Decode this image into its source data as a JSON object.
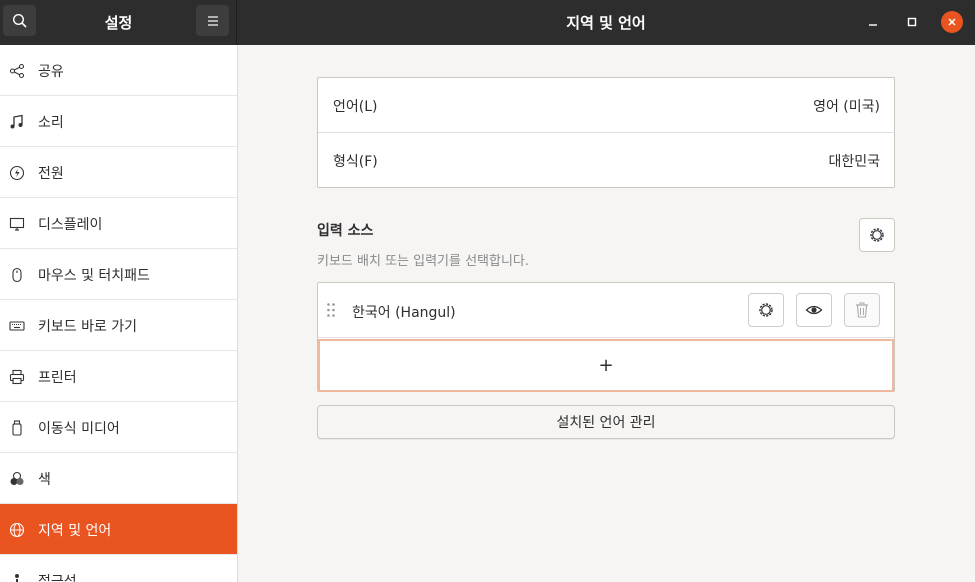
{
  "header": {
    "left_title": "설정",
    "title": "지역 및 언어"
  },
  "sidebar": {
    "items": [
      {
        "label": "공유",
        "icon": "share-icon"
      },
      {
        "label": "소리",
        "icon": "music-note-icon"
      },
      {
        "label": "전원",
        "icon": "power-icon"
      },
      {
        "label": "디스플레이",
        "icon": "display-icon"
      },
      {
        "label": "마우스 및 터치패드",
        "icon": "mouse-icon"
      },
      {
        "label": "키보드 바로 가기",
        "icon": "keyboard-icon"
      },
      {
        "label": "프린터",
        "icon": "printer-icon"
      },
      {
        "label": "이동식 미디어",
        "icon": "usb-drive-icon"
      },
      {
        "label": "색",
        "icon": "color-icon"
      },
      {
        "label": "지역 및 언어",
        "icon": "globe-icon",
        "active": true
      },
      {
        "label": "접근성",
        "icon": "accessibility-icon"
      }
    ]
  },
  "language": {
    "language_label": "언어(L)",
    "language_value": "영어 (미국)",
    "formats_label": "형식(F)",
    "formats_value": "대한민국"
  },
  "input_sources": {
    "title": "입력 소스",
    "subtitle": "키보드 배치 또는 입력기를 선택합니다.",
    "items": [
      {
        "name": "한국어 (Hangul)"
      }
    ],
    "add_symbol": "+"
  },
  "manage_button": "설치된 언어 관리",
  "colors": {
    "accent": "#e95420",
    "header_bg": "#2d2d2d"
  }
}
